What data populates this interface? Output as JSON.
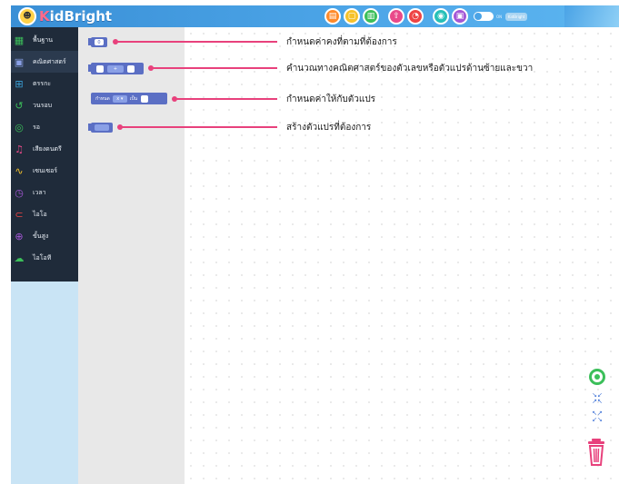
{
  "header": {
    "logo_text_k": "K",
    "logo_text_rest": "idBright",
    "logo_face": "☻",
    "buttons": [
      {
        "name": "new-file-icon",
        "glyph": "▤"
      },
      {
        "name": "open-file-icon",
        "glyph": "▢"
      },
      {
        "name": "save-file-icon",
        "glyph": "▥"
      },
      {
        "name": "upload-icon",
        "glyph": "⇧"
      },
      {
        "name": "alarm-clock-icon",
        "glyph": "◔"
      },
      {
        "name": "wifi-icon",
        "glyph": "◉"
      },
      {
        "name": "board-icon",
        "glyph": "▣"
      }
    ],
    "toggle_label": "ON",
    "mode_label": "KidBright"
  },
  "sidebar": {
    "items": [
      {
        "label": "พื้นฐาน",
        "icon": "basic-grid-icon",
        "glyph": "▦",
        "color": "#3cbf5a"
      },
      {
        "label": "คณิตศาสตร์",
        "icon": "math-icon",
        "glyph": "▣",
        "color": "#5b6fc4"
      },
      {
        "label": "ตรรกะ",
        "icon": "logic-icon",
        "glyph": "⊞",
        "color": "#3aa0d6"
      },
      {
        "label": "วนรอบ",
        "icon": "loop-icon",
        "glyph": "↺",
        "color": "#3cbf5a"
      },
      {
        "label": "รอ",
        "icon": "wait-icon",
        "glyph": "◎",
        "color": "#3cbf5a"
      },
      {
        "label": "เสียงดนตรี",
        "icon": "music-icon",
        "glyph": "♫",
        "color": "#e94a8a"
      },
      {
        "label": "เซนเซอร์",
        "icon": "sensor-icon",
        "glyph": "∿",
        "color": "#f6c22b"
      },
      {
        "label": "เวลา",
        "icon": "clock-icon",
        "glyph": "◷",
        "color": "#a457d6"
      },
      {
        "label": "ไอโอ",
        "icon": "io-icon",
        "glyph": "⊂",
        "color": "#ee4444"
      },
      {
        "label": "ขั้นสูง",
        "icon": "advanced-icon",
        "glyph": "⊕",
        "color": "#a457d6"
      },
      {
        "label": "ไอโอที",
        "icon": "iot-icon",
        "glyph": "☁",
        "color": "#3cbf5a"
      }
    ]
  },
  "blocks": {
    "number_value": "0",
    "op_value": "+",
    "set_label": "กำหนด",
    "set_var": "x ▾",
    "set_to": "เป็น"
  },
  "descriptions": {
    "d1": "กำหนดค่าคงที่ตามที่ต้องการ",
    "d2": "คำนวณทางคณิตศาสตร์ของตัวเลขหรือตัวแปรด้านซ้ายและขวา",
    "d3": "กำหนดค่าให้กับตัวแปร",
    "d4": "สร้างตัวแปรที่ต้องการ"
  },
  "tools": {
    "zoom_in": "↘↙ ↗↖",
    "zoom_out": "↖↗ ↙↘"
  },
  "colors": {
    "accent": "#e8417c",
    "block": "#5b6fc4",
    "sidebar": "#1f2b3a",
    "header": "#4aa3e6"
  }
}
